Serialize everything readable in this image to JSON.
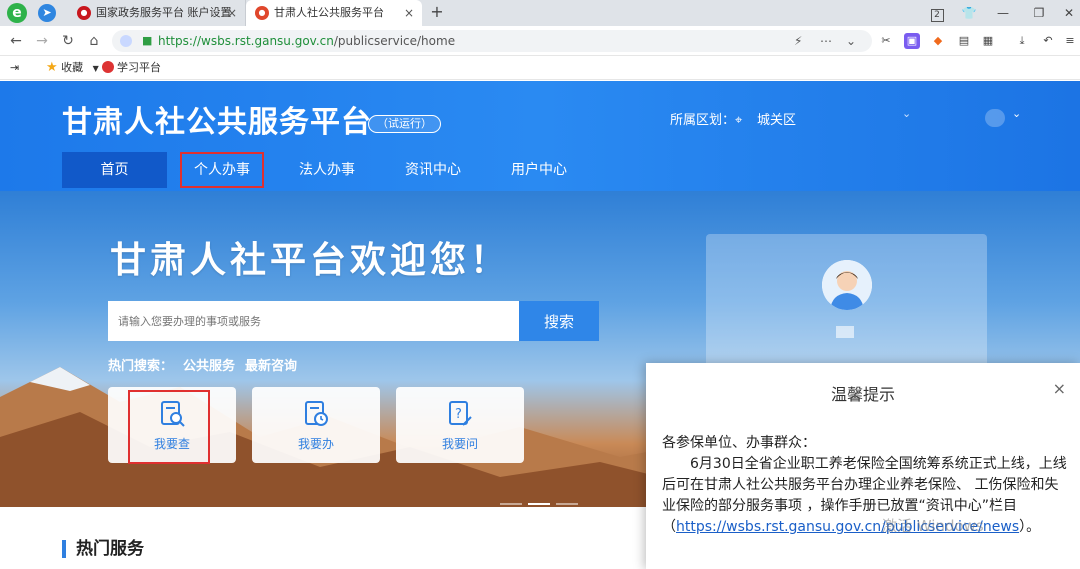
{
  "browser": {
    "logo": "e",
    "tabs": [
      {
        "title": "国家政务服务平台 账户设置",
        "close": "×"
      },
      {
        "title": "甘肃人社公共服务平台",
        "close": "×"
      }
    ],
    "new_tab": "+",
    "badge_num": "2",
    "url_host": "https://wsbs.rst.gansu.gov.cn",
    "url_path": "/publicservice/home",
    "bookmarks": {
      "fav_label": "收藏",
      "study_label": "学习平台"
    }
  },
  "header": {
    "title": "甘肃人社公共服务平台",
    "badge": "（试运行）",
    "region_label": "所属区划：",
    "region_value": "城关区",
    "nav": [
      "首页",
      "个人办事",
      "法人办事",
      "资讯中心",
      "用户中心"
    ]
  },
  "banner": {
    "welcome": "甘肃人社平台欢迎您！",
    "search_placeholder": "请输入您要办理的事项或服务",
    "search_button": "搜索",
    "hot_label": "热门搜索：",
    "hot_items": [
      "公共服务",
      "最新咨询"
    ],
    "quick": [
      "我要查",
      "我要办",
      "我要问"
    ]
  },
  "section": {
    "hot_services": "热门服务"
  },
  "modal": {
    "title": "温馨提示",
    "close": "×",
    "greeting": "各参保单位、办事群众：",
    "para": "6月30日全省企业职工养老保险全国统筹系统正式上线，上线后可在甘肃人社公共服务平台办理企业养老保险、 工伤保险和失业保险的部分服务事项 ，操作手册已放置“资讯中心”栏目（",
    "link": "https://wsbs.rst.gansu.gov.cn/publicservice/news",
    "tail": "）。"
  },
  "watermark": "激活 Windows",
  "colors": {
    "primary": "#1d79ea",
    "nav_active": "#1159c9",
    "highlight": "#e03030",
    "link": "#1a5fc8"
  }
}
